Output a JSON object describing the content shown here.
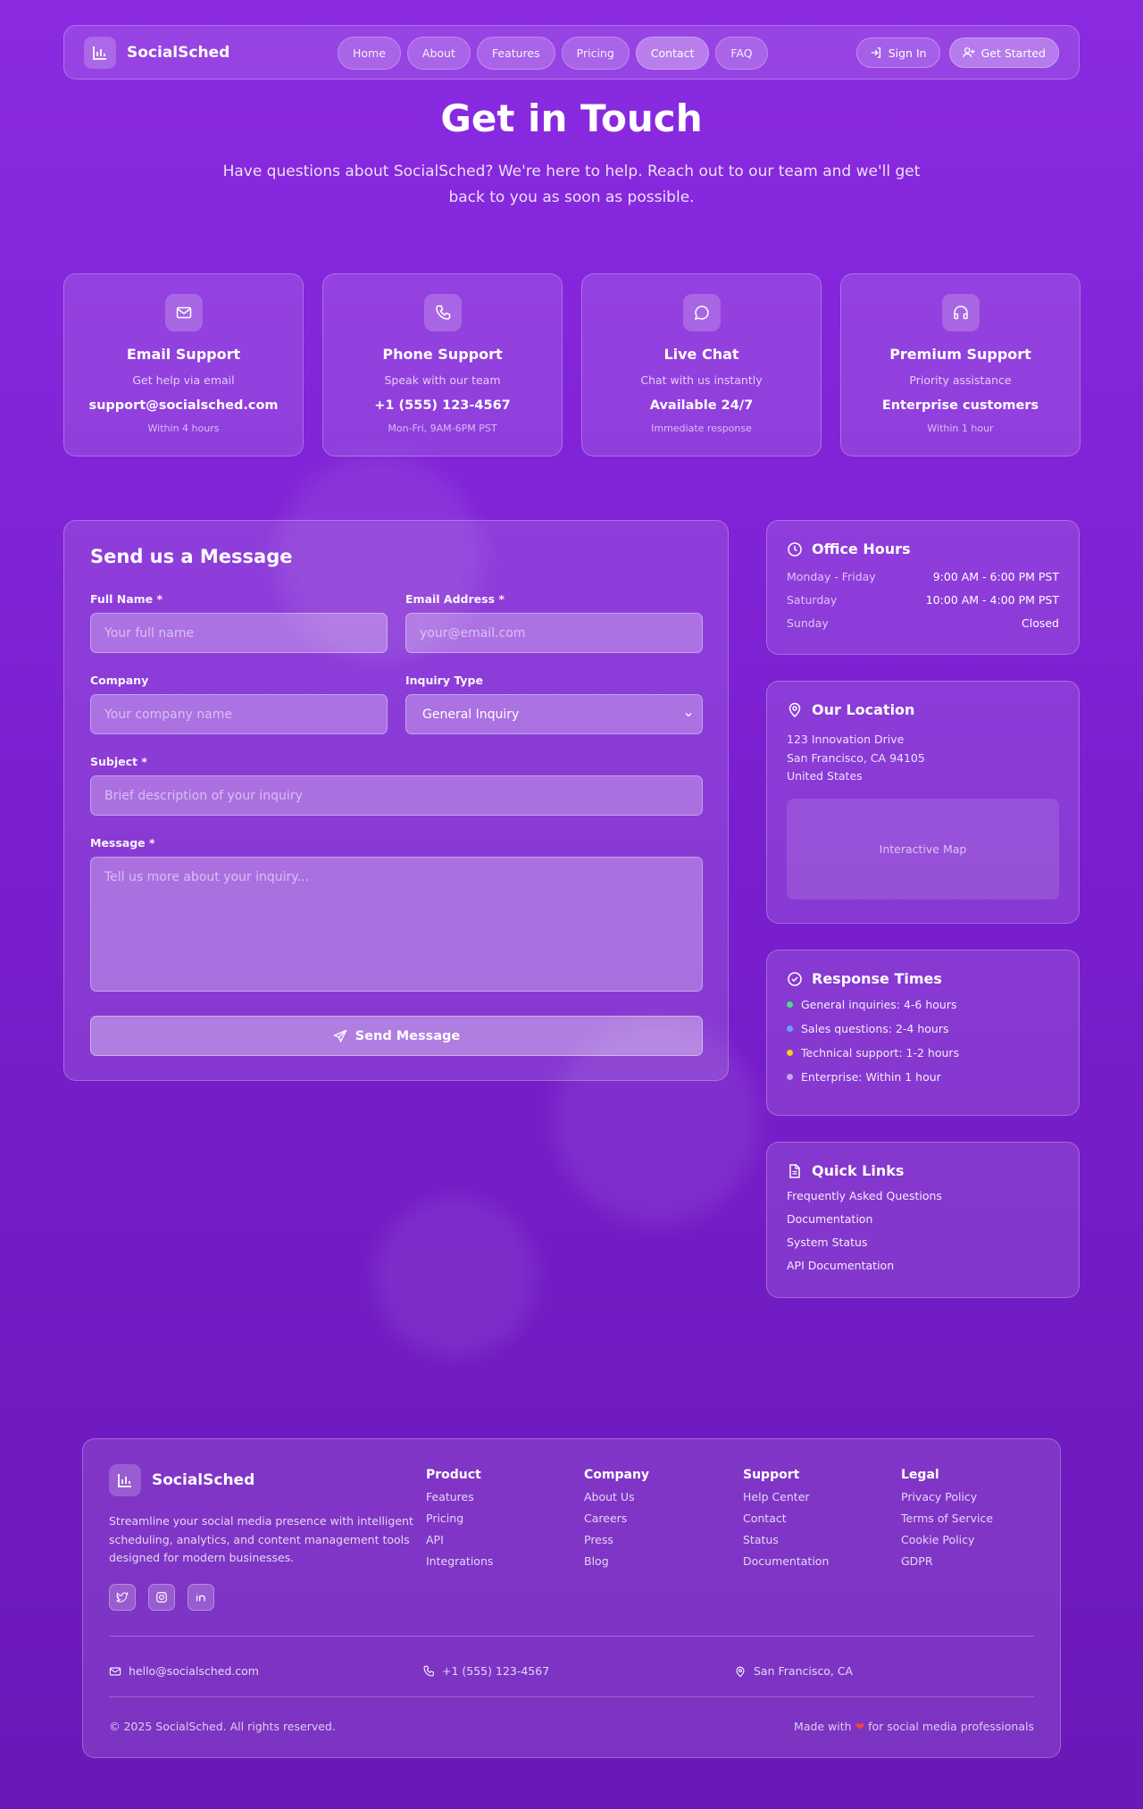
{
  "nav": {
    "brand": "SocialSched",
    "links": [
      "Home",
      "About",
      "Features",
      "Pricing",
      "Contact",
      "FAQ"
    ],
    "active": "Contact",
    "sign_in": "Sign In",
    "get_started": "Get Started"
  },
  "hero": {
    "title": "Get in Touch",
    "subtitle": "Have questions about SocialSched? We're here to help. Reach out to our team and we'll get back to you as soon as possible."
  },
  "contact_cards": [
    {
      "icon": "mail-icon",
      "title": "Email Support",
      "desc": "Get help via email",
      "value": "support@socialsched.com",
      "note": "Within 4 hours"
    },
    {
      "icon": "phone-icon",
      "title": "Phone Support",
      "desc": "Speak with our team",
      "value": "+1 (555) 123-4567",
      "note": "Mon-Fri, 9AM-6PM PST"
    },
    {
      "icon": "chat-icon",
      "title": "Live Chat",
      "desc": "Chat with us instantly",
      "value": "Available 24/7",
      "note": "Immediate response"
    },
    {
      "icon": "headphones-icon",
      "title": "Premium Support",
      "desc": "Priority assistance",
      "value": "Enterprise customers",
      "note": "Within 1 hour"
    }
  ],
  "form": {
    "title": "Send us a Message",
    "full_name_label": "Full Name *",
    "full_name_placeholder": "Your full name",
    "email_label": "Email Address *",
    "email_placeholder": "your@email.com",
    "company_label": "Company",
    "company_placeholder": "Your company name",
    "inquiry_label": "Inquiry Type",
    "inquiry_value": "General Inquiry",
    "subject_label": "Subject *",
    "subject_placeholder": "Brief description of your inquiry",
    "message_label": "Message *",
    "message_placeholder": "Tell us more about your inquiry...",
    "send_label": "Send Message"
  },
  "office_hours": {
    "title": "Office Hours",
    "rows": [
      {
        "day": "Monday - Friday",
        "hours": "9:00 AM - 6:00 PM PST"
      },
      {
        "day": "Saturday",
        "hours": "10:00 AM - 4:00 PM PST"
      },
      {
        "day": "Sunday",
        "hours": "Closed"
      }
    ]
  },
  "location": {
    "title": "Our Location",
    "line1": "123 Innovation Drive",
    "line2": "San Francisco, CA 94105",
    "line3": "United States",
    "map_label": "Interactive Map"
  },
  "response_times": {
    "title": "Response Times",
    "items": [
      {
        "text": "General inquiries: 4-6 hours",
        "color": "#4ade80"
      },
      {
        "text": "Sales questions: 2-4 hours",
        "color": "#60a5fa"
      },
      {
        "text": "Technical support: 1-2 hours",
        "color": "#facc15"
      },
      {
        "text": "Enterprise: Within 1 hour",
        "color": "#c4a5f5"
      }
    ]
  },
  "quick_links": {
    "title": "Quick Links",
    "items": [
      "Frequently Asked Questions",
      "Documentation",
      "System Status",
      "API Documentation"
    ]
  },
  "footer": {
    "brand": "SocialSched",
    "description": "Streamline your social media presence with intelligent scheduling, analytics, and content management tools designed for modern businesses.",
    "columns": [
      {
        "title": "Product",
        "links": [
          "Features",
          "Pricing",
          "API",
          "Integrations"
        ]
      },
      {
        "title": "Company",
        "links": [
          "About Us",
          "Careers",
          "Press",
          "Blog"
        ]
      },
      {
        "title": "Support",
        "links": [
          "Help Center",
          "Contact",
          "Status",
          "Documentation"
        ]
      },
      {
        "title": "Legal",
        "links": [
          "Privacy Policy",
          "Terms of Service",
          "Cookie Policy",
          "GDPR"
        ]
      }
    ],
    "email": "hello@socialsched.com",
    "phone": "+1 (555) 123-4567",
    "location": "San Francisco, CA",
    "copyright": "© 2025 SocialSched. All rights reserved.",
    "made_with_prefix": "Made with",
    "made_with_suffix": "for social media professionals"
  }
}
